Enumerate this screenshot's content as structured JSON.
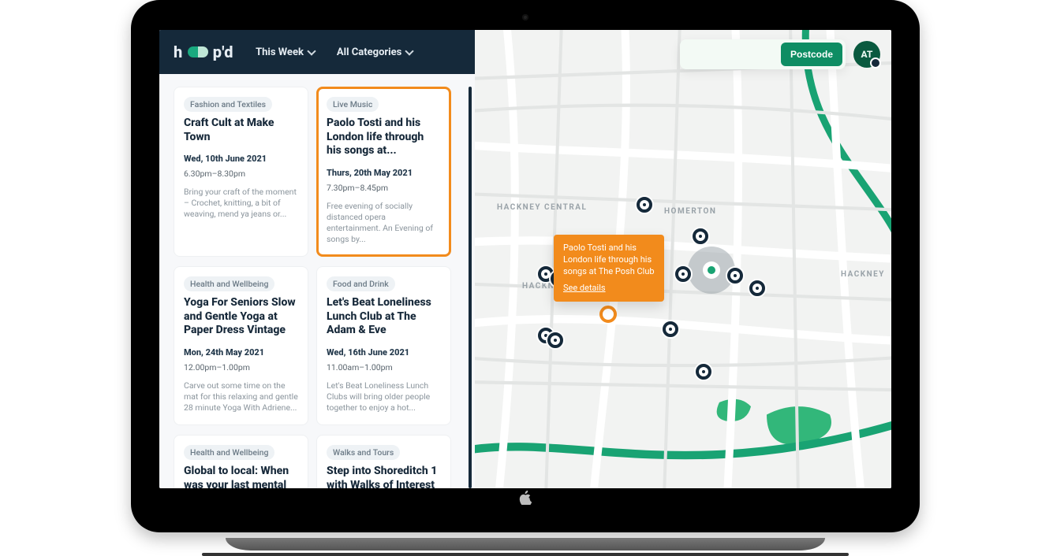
{
  "brand": {
    "prefix": "h",
    "suffix": "p'd"
  },
  "nav": {
    "this_week": "This Week",
    "all_categories": "All Categories"
  },
  "search": {
    "placeholder": "",
    "button": "Postcode",
    "avatar_initials": "AT"
  },
  "map": {
    "tooltip_title": "Paolo Tosti and his London life through his songs at The Posh Club",
    "tooltip_link": "See details",
    "labels": {
      "hackney_central": "HACKNEY CENTRAL",
      "homerton": "HOMERTON",
      "hackney": "HACKNEY",
      "hackn_edge": "HACKN"
    }
  },
  "events": [
    {
      "category": "Fashion and Textiles",
      "title": "Craft Cult at Make Town",
      "date": "Wed, 10th June 2021",
      "time": "6.30pm–8.30pm",
      "desc": "Bring your craft of the moment – Crochet, knitting, a bit of weaving, mend ya jeans or...",
      "selected": false
    },
    {
      "category": "Live Music",
      "title": "Paolo Tosti and his London life through his songs at...",
      "date": "Thurs, 20th May 2021",
      "time": "7.30pm–8.45pm",
      "desc": "Free evening of socially distanced opera entertainment. An Evening of songs by...",
      "selected": true
    },
    {
      "category": "Health and Wellbeing",
      "title": "Yoga For Seniors Slow and Gentle Yoga at Paper Dress Vintage",
      "date": "Mon, 24th May 2021",
      "time": "12.00pm–1.00pm",
      "desc": "Carve out some time on the mat for this relaxing and gentle 28 minute Yoga With Adriene...",
      "selected": false
    },
    {
      "category": "Food and Drink",
      "title": "Let's Beat Loneliness Lunch Club at The Adam & Eve",
      "date": "Wed, 16th June 2021",
      "time": "11.00am–1.00pm",
      "desc": "Let's Beat Loneliness Lunch Clubs will bring older people together to enjoy a hot...",
      "selected": false
    },
    {
      "category": "Health and Wellbeing",
      "title": "Global to local: When was your last mental health check?...",
      "date": "",
      "time": "",
      "desc": "",
      "selected": false
    },
    {
      "category": "Walks and Tours",
      "title": "Step into Shoreditch 1 with Walks of Interest",
      "date": "",
      "time": "",
      "desc": "",
      "selected": false
    }
  ]
}
